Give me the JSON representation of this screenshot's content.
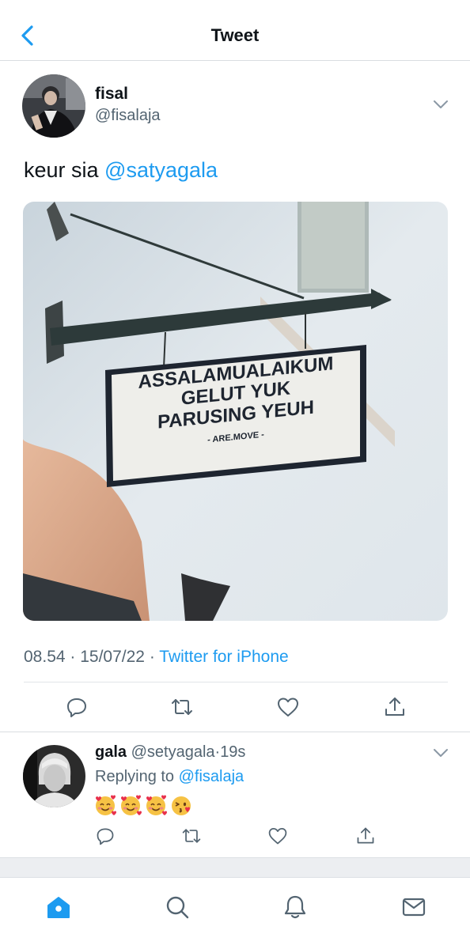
{
  "header": {
    "title": "Tweet",
    "back_icon": "chevron-left-icon"
  },
  "tweet": {
    "author_name": "fisal",
    "author_handle": "@fisalaja",
    "text_prefix": "keur sia ",
    "text_mention": "@satyagala",
    "image": {
      "sign_line1": "ASSALAMUALAIKUM",
      "sign_line2": "GELUT YUK",
      "sign_line3": "PARUSING YEUH",
      "sign_credit": "- ARE.MOVE -"
    },
    "time": "08.54",
    "sep1": " · ",
    "date": "15/07/22",
    "sep2": " · ",
    "source": "Twitter for iPhone",
    "actions": [
      "reply-icon",
      "retweet-icon",
      "like-icon",
      "share-icon"
    ]
  },
  "reply": {
    "name": "gala",
    "handle": "@setyagala",
    "sep": "·",
    "time": "19s",
    "replying_label": "Replying to ",
    "replying_to": "@fisalaja",
    "emojis": [
      "smiling-face-with-hearts",
      "smiling-face-with-hearts",
      "smiling-face-with-hearts",
      "face-blowing-kiss"
    ]
  },
  "tabbar": {
    "items": [
      "home-icon",
      "search-icon",
      "notifications-icon",
      "messages-icon"
    ]
  },
  "colors": {
    "accent": "#1d9bf0",
    "text": "#0f1419",
    "secondary": "#536471",
    "divider": "#e1e5e8"
  }
}
